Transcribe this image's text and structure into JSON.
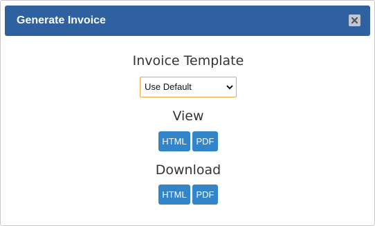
{
  "dialog": {
    "title": "Generate Invoice",
    "close_icon": "close-x-icon"
  },
  "template": {
    "heading": "Invoice Template",
    "selected": "Use Default",
    "dropdown_icon": "chevron-down-icon"
  },
  "view": {
    "heading": "View",
    "html_label": "HTML",
    "pdf_label": "PDF"
  },
  "download": {
    "heading": "Download",
    "html_label": "HTML",
    "pdf_label": "PDF"
  },
  "colors": {
    "titlebar": "#2f61a0",
    "button": "#3385c9",
    "select_border": "#f0a64c",
    "close_button": "#c3c7cd"
  }
}
